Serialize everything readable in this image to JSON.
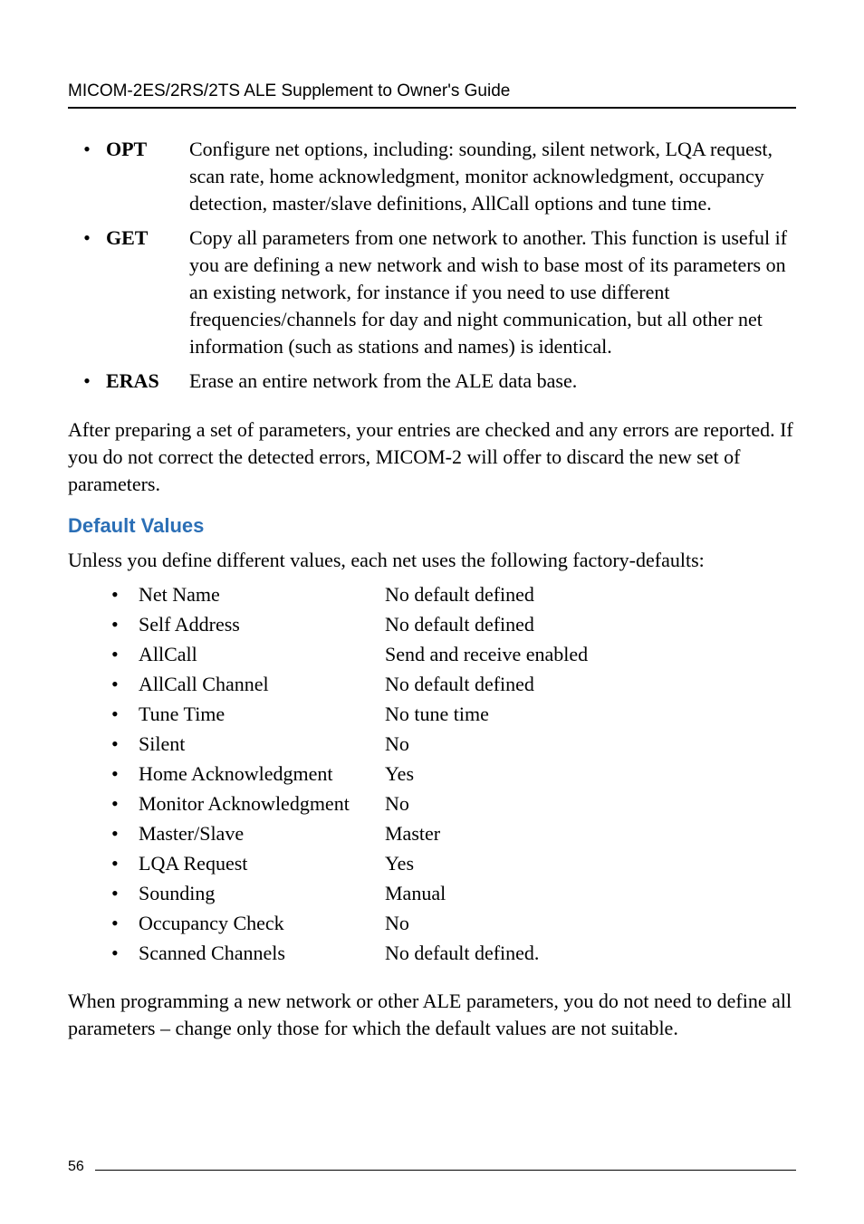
{
  "header": "MICOM-2ES/2RS/2TS ALE Supplement to Owner's Guide",
  "commands": [
    {
      "name": "OPT",
      "desc": "Configure net options, including: sounding, silent network, LQA request, scan rate, home acknowledgment, monitor acknowledgment, occupancy detection, master/slave definitions, AllCall options and tune time."
    },
    {
      "name": "GET",
      "desc": "Copy all parameters from one network to another. This function is useful if you are defining a new network and wish to base most of its parameters on an existing network, for instance if you need to use different frequencies/channels for day and night communication, but all other net information (such as stations and names) is identical."
    },
    {
      "name": "ERAS",
      "desc": "Erase an entire network from the ALE data base."
    }
  ],
  "after_commands_para": "After preparing a set of parameters, your entries are checked and any errors are reported. If you do not correct the detected errors, MICOM-2 will offer to discard the new set of parameters.",
  "section_heading": "Default Values",
  "defaults_intro": "Unless you define different values, each net uses the following factory-defaults:",
  "defaults": [
    {
      "label": "Net Name",
      "value": "No default defined"
    },
    {
      "label": "Self Address",
      "value": "No default defined"
    },
    {
      "label": "AllCall",
      "value": "Send and receive enabled"
    },
    {
      "label": "AllCall Channel",
      "value": "No default defined"
    },
    {
      "label": "Tune Time",
      "value": "No tune time"
    },
    {
      "label": "Silent",
      "value": "No"
    },
    {
      "label": "Home Acknowledgment",
      "value": "Yes"
    },
    {
      "label": "Monitor Acknowledgment",
      "value": "No"
    },
    {
      "label": "Master/Slave",
      "value": "Master"
    },
    {
      "label": "LQA Request",
      "value": "Yes"
    },
    {
      "label": "Sounding",
      "value": "Manual"
    },
    {
      "label": "Occupancy Check",
      "value": "No"
    },
    {
      "label": "Scanned Channels",
      "value": "No default defined."
    }
  ],
  "closing_para": "When programming a new network or other ALE parameters, you do not need to define all parameters – change only those for which the default values are not suitable.",
  "page_number": "56"
}
